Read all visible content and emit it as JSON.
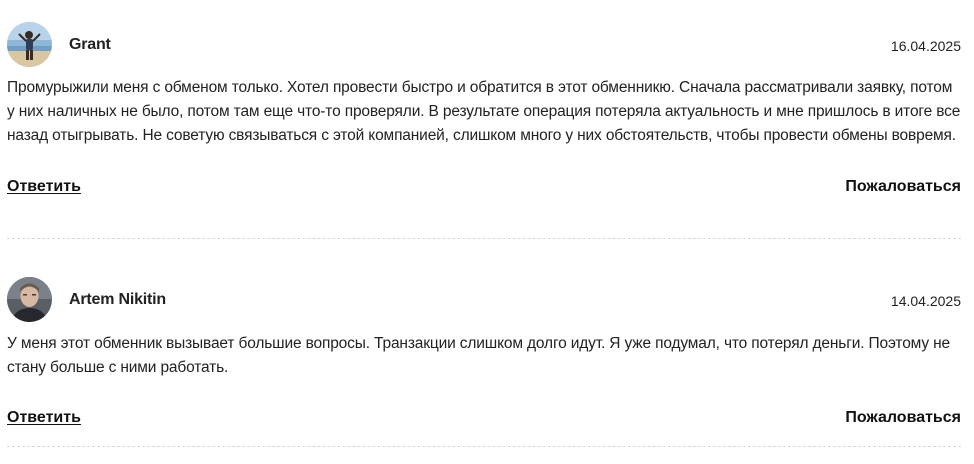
{
  "reviews": [
    {
      "author": "Grant",
      "date": "16.04.2025",
      "avatar_icon": "user-photo-beach",
      "text": "Промурыжили меня с обменом только. Хотел провести быстро и обратится в этот обменникю. Сначала рассматривали заявку, потом у них наличных не было, потом там еще что-то проверяли. В результате операция потеряла актуальность и мне пришлось в итоге все назад отыгрывать. Не советую связываться с этой компанией, слишком много у них обстоятельств, чтобы провести обмены вовремя.",
      "reply_label": "Ответить",
      "complain_label": "Пожаловаться"
    },
    {
      "author": "Artem Nikitin",
      "date": "14.04.2025",
      "avatar_icon": "user-photo-portrait",
      "text": "У меня этот обменник вызывает большие вопросы. Транзакции слишком долго идут. Я уже подумал, что потерял деньги. Поэтому не стану больше с ними работать.",
      "reply_label": "Ответить",
      "complain_label": "Пожаловаться"
    }
  ],
  "colors": {
    "text": "#222222",
    "divider": "#d8d8d8"
  }
}
